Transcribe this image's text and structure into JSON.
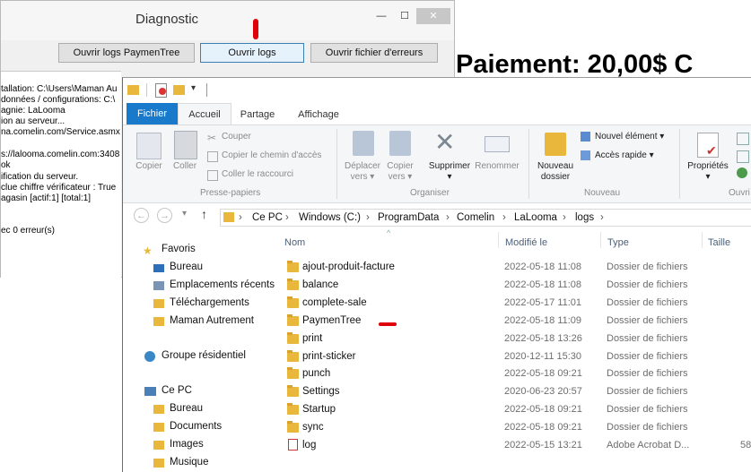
{
  "diagnostic": {
    "title": "Diagnostic",
    "minimize": "—",
    "maximize": "☐",
    "close": "✕",
    "buttons": {
      "paymentree": "Ouvrir logs PaymenTree",
      "logs": "Ouvrir logs",
      "errors": "Ouvrir fichier d'erreurs"
    },
    "log_lines": [
      "tallation: C:\\Users\\Maman Au",
      "données / configurations: C:\\",
      "agnie: LaLooma",
      "ion au serveur...",
      "na.comelin.com/Service.asmx",
      "",
      "s://lalooma.comelin.com:3408",
      "ok",
      "ification du serveur.",
      "clue chiffre vérificateur : True",
      "agasin  [actif:1] [total:1]",
      "",
      "",
      "ec 0 erreur(s)"
    ]
  },
  "background_heading": "Paiement: 20,00$  C",
  "explorer": {
    "tabs": {
      "fichier": "Fichier",
      "accueil": "Accueil",
      "partage": "Partage",
      "affichage": "Affichage"
    },
    "ribbon": {
      "copier": "Copier",
      "coller": "Coller",
      "couper": "Couper",
      "copier_chemin": "Copier le chemin d'accès",
      "coller_raccourci": "Coller le raccourci",
      "presse_papiers": "Presse-papiers",
      "deplacer_l1": "Déplacer",
      "deplacer_l2": "vers ▾",
      "copier_vers_l1": "Copier",
      "copier_vers_l2": "vers ▾",
      "supprimer": "Supprimer",
      "supprimer_arrow": "▾",
      "renommer": "Renommer",
      "organiser": "Organiser",
      "nouveau_dossier_l1": "Nouveau",
      "nouveau_dossier_l2": "dossier",
      "nouvel_element": "Nouvel élément ▾",
      "acces_rapide": "Accès rapide ▾",
      "nouveau": "Nouveau",
      "proprietes": "Propriétés",
      "proprietes_arrow": "▾",
      "ouvrir": "Ouvri"
    },
    "address": {
      "back": "←",
      "forward": "→",
      "recent": "▾",
      "up": "↑",
      "segments": [
        "Ce PC",
        "Windows (C:)",
        "ProgramData",
        "Comelin",
        "LaLooma",
        "logs"
      ]
    },
    "nav": {
      "favoris": "Favoris",
      "bureau": "Bureau",
      "emplacements": "Emplacements récents",
      "telechargements": "Téléchargements",
      "maman": "Maman Autrement",
      "groupe": "Groupe résidentiel",
      "ce_pc": "Ce PC",
      "bureau2": "Bureau",
      "documents": "Documents",
      "images": "Images",
      "musique": "Musique"
    },
    "columns": {
      "nom": "Nom",
      "modifie": "Modifié le",
      "type": "Type",
      "taille": "Taille",
      "sort": "^"
    },
    "files": [
      {
        "name": "ajout-produit-facture",
        "date": "2022-05-18 11:08",
        "type": "Dossier de fichiers",
        "size": ""
      },
      {
        "name": "balance",
        "date": "2022-05-18 11:08",
        "type": "Dossier de fichiers",
        "size": ""
      },
      {
        "name": "complete-sale",
        "date": "2022-05-17 11:01",
        "type": "Dossier de fichiers",
        "size": ""
      },
      {
        "name": "PaymenTree",
        "date": "2022-05-18 11:09",
        "type": "Dossier de fichiers",
        "size": ""
      },
      {
        "name": "print",
        "date": "2022-05-18 13:26",
        "type": "Dossier de fichiers",
        "size": ""
      },
      {
        "name": "print-sticker",
        "date": "2020-12-11 15:30",
        "type": "Dossier de fichiers",
        "size": ""
      },
      {
        "name": "punch",
        "date": "2022-05-18 09:21",
        "type": "Dossier de fichiers",
        "size": ""
      },
      {
        "name": "Settings",
        "date": "2020-06-23 20:57",
        "type": "Dossier de fichiers",
        "size": ""
      },
      {
        "name": "Startup",
        "date": "2022-05-18 09:21",
        "type": "Dossier de fichiers",
        "size": ""
      },
      {
        "name": "sync",
        "date": "2022-05-18 09:21",
        "type": "Dossier de fichiers",
        "size": ""
      },
      {
        "name": "log",
        "date": "2022-05-15 13:21",
        "type": "Adobe Acrobat D...",
        "size": "58"
      }
    ]
  }
}
